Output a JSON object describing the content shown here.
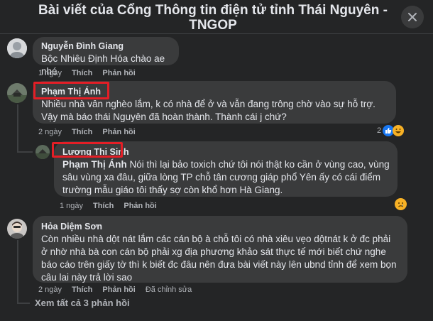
{
  "header": {
    "title": "Bài viết của Cổng Thông tin điện tử tỉnh Thái Nguyên - TNGOP",
    "close_icon": "close-icon"
  },
  "comments": [
    {
      "author": "Nguyễn Đình Giang",
      "text": "Bộc Nhiêu Định Hóa chào ae nhé",
      "time": "1 ngày",
      "like": "Thích",
      "reply": "Phản hồi"
    },
    {
      "author": "Phạm Thị Ánh",
      "text": "Nhiều nhà vẫn nghèo lắm, k có nhà để ở và vẫn đang trông chờ vào sự hỗ trợ. Vậy mà báo thái Nguyên đã hoàn thành. Thành cái j chứ?",
      "time": "2 ngày",
      "like": "Thích",
      "reply": "Phản hồi",
      "reaction_count": "2",
      "reaction_icons": [
        "like-icon",
        "haha-icon"
      ]
    },
    {
      "author": "Lương Thị Sinh",
      "mention": "Phạm Thị Ánh",
      "text": " Nói thì lại bảo toxich chứ tôi nói thật ko cần ở vùng cao, vùng sâu vùng xa đâu, giữa lòng TP chỗ tân cương giáp phổ Yên ấy có cái điểm trường mẫu giáo tôi thấy sợ còn khổ hơn Hà Giang.",
      "time": "1 ngày",
      "like": "Thích",
      "reply": "Phản hồi",
      "reaction_icons": [
        "sad-icon"
      ]
    },
    {
      "author": "Hỏa Diệm Sơn",
      "text": "Còn nhiều nhà dột nát lắm các cán bộ à chỗ tôi có nhà xiêu vẹo dộtnát k ở đc phải ở nhờ nhà bà con cán bộ phải xg địa phương khảo sát thực tế mới biết chứ nghe báo cáo trên giấy tờ thì k biết đc đâu nên đưa bài viết này lên ubnd tỉnh để xem bọn câu lai này trả lời sao",
      "time": "2 ngày",
      "like": "Thích",
      "reply": "Phản hồi",
      "edited": "Đã chỉnh sửa"
    }
  ],
  "view_more": "Xem tất cả 3 phản hồi",
  "colors": {
    "background": "#242526",
    "bubble": "#3a3b3c",
    "highlight_box": "#e41e26",
    "like_blue": "#1877f2"
  }
}
